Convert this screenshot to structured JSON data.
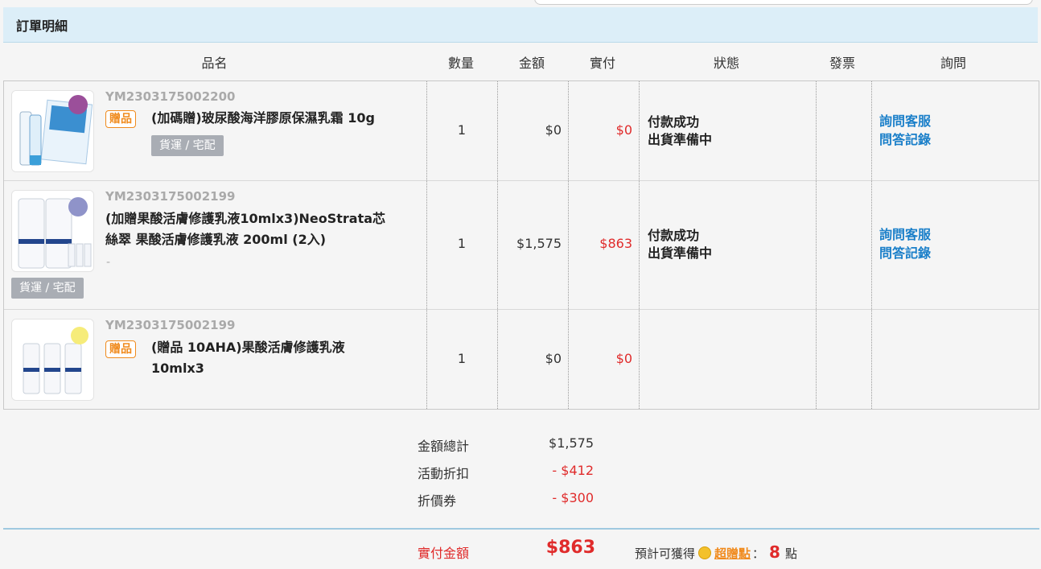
{
  "section_title": "訂單明細",
  "columns": [
    "品名",
    "數量",
    "金額",
    "實付",
    "狀態",
    "發票",
    "詢問"
  ],
  "items": [
    {
      "sku": "YM2303175002200",
      "gift_badge": "贈品",
      "name": "(加碼贈)玻尿酸海洋膠原保濕乳霜 10g",
      "shipping": "貨運 / 宅配",
      "qty": "1",
      "amount": "$0",
      "paid": "$0",
      "status_line1": "付款成功",
      "status_line2": "出貨準備中",
      "ask_service": "詢問客服",
      "ask_history": "問答記錄"
    },
    {
      "sku": "YM2303175002199",
      "name_line1": "(加贈果酸活膚修護乳液10mlx3)NeoStrata芯",
      "name_line2": "絲翠 果酸活膚修護乳液 200ml (2入)",
      "dash": "-",
      "shipping": "貨運 / 宅配",
      "qty": "1",
      "amount": "$1,575",
      "paid": "$863",
      "status_line1": "付款成功",
      "status_line2": "出貨準備中",
      "ask_service": "詢問客服",
      "ask_history": "問答記錄"
    },
    {
      "sku": "YM2303175002199",
      "gift_badge": "贈品",
      "name_line1": "(贈品 10AHA)果酸活膚修護乳液",
      "name_line2": "10mlx3",
      "qty": "1",
      "amount": "$0",
      "paid": "$0"
    }
  ],
  "summary": {
    "subtotal_label": "金額總計",
    "subtotal_value": "$1,575",
    "discount_label": "活動折扣",
    "discount_value": "- $412",
    "coupon_label": "折價券",
    "coupon_value": "- $300",
    "paid_label": "實付金額",
    "paid_value": "$863",
    "points_prefix": "預計可獲得",
    "points_link": "超贈點",
    "points_colon": "：",
    "points_value": "8",
    "points_unit": "點"
  },
  "colors": {
    "accent_blue": "#1a7fc9",
    "price_red": "#e02b2b",
    "gift_orange": "#f08a1c",
    "header_bg": "#dceef8"
  }
}
